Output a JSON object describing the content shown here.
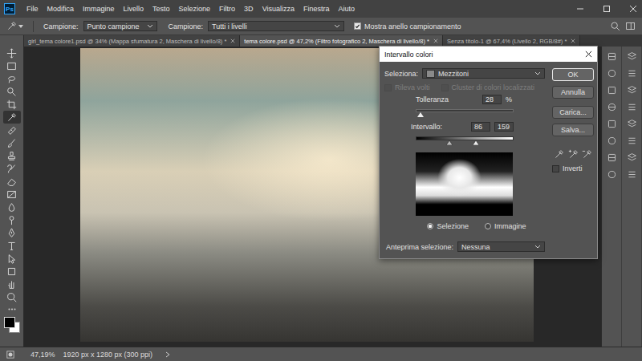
{
  "app": {
    "logo": "Ps"
  },
  "menu": [
    "File",
    "Modifica",
    "Immagine",
    "Livello",
    "Testo",
    "Selezione",
    "Filtro",
    "3D",
    "Visualizza",
    "Finestra",
    "Aiuto"
  ],
  "options_bar": {
    "sample_size": {
      "label": "Campione:",
      "value": "Punto campione"
    },
    "sample": {
      "label": "Campione:",
      "value": "Tutti i livelli"
    },
    "ring": {
      "label": "Mostra anello campionamento",
      "checked": true
    }
  },
  "tabs": [
    {
      "label": "girl_tema colore1.psd @ 34% (Mappa sfumatura 2, Maschera di livello/8) *",
      "selected": false
    },
    {
      "label": "tema colore.psd @ 47,2% (Filtro fotografico 2, Maschera di livello/8) *",
      "selected": true
    },
    {
      "label": "Senza titolo-1 @ 67,4% (Livello 2, RGB/8#) *",
      "selected": false
    }
  ],
  "toolbar": {
    "tools": [
      {
        "selected": false
      },
      {
        "selected": false
      },
      {
        "selected": false
      },
      {
        "selected": false
      },
      {
        "selected": false
      },
      {
        "selected": true
      },
      {
        "selected": false
      },
      {
        "selected": false
      },
      {
        "selected": false
      },
      {
        "selected": false
      },
      {
        "selected": false
      },
      {
        "selected": false
      },
      {
        "selected": false
      },
      {
        "selected": false
      },
      {
        "selected": false
      },
      {
        "selected": false
      },
      {
        "selected": false
      },
      {
        "selected": false
      },
      {
        "selected": false
      },
      {
        "selected": false
      }
    ]
  },
  "status_bar": {
    "zoom": "47,19%",
    "info": "1920 px x 1280 px (300 ppi)"
  },
  "dialog": {
    "title": "Intervallo colori",
    "select": {
      "label": "Seleziona:",
      "value": "Mezzitoni"
    },
    "options": [
      {
        "label": "Rileva volti",
        "checked": false,
        "disabled": true
      },
      {
        "label": "Cluster di colori localizzati",
        "checked": false,
        "disabled": true
      }
    ],
    "tolerance": {
      "label": "Tolleranza",
      "value": "28",
      "unit": "%",
      "level": 0.04
    },
    "range": {
      "label": "Intervallo:",
      "low": "86",
      "high": "159",
      "low_level": 0.34,
      "high_level": 0.62
    },
    "view": [
      {
        "label": "Selezione",
        "selected": true
      },
      {
        "label": "Immagine",
        "selected": false
      }
    ],
    "preview": {
      "label": "Anteprima selezione:",
      "value": "Nessuna"
    },
    "buttons": [
      {
        "label": "OK",
        "default": true
      },
      {
        "label": "Annulla",
        "default": false
      },
      {
        "label": "Carica...",
        "default": false
      },
      {
        "label": "Salva...",
        "default": false
      }
    ],
    "invert": {
      "label": "Inverti",
      "checked": false
    }
  }
}
